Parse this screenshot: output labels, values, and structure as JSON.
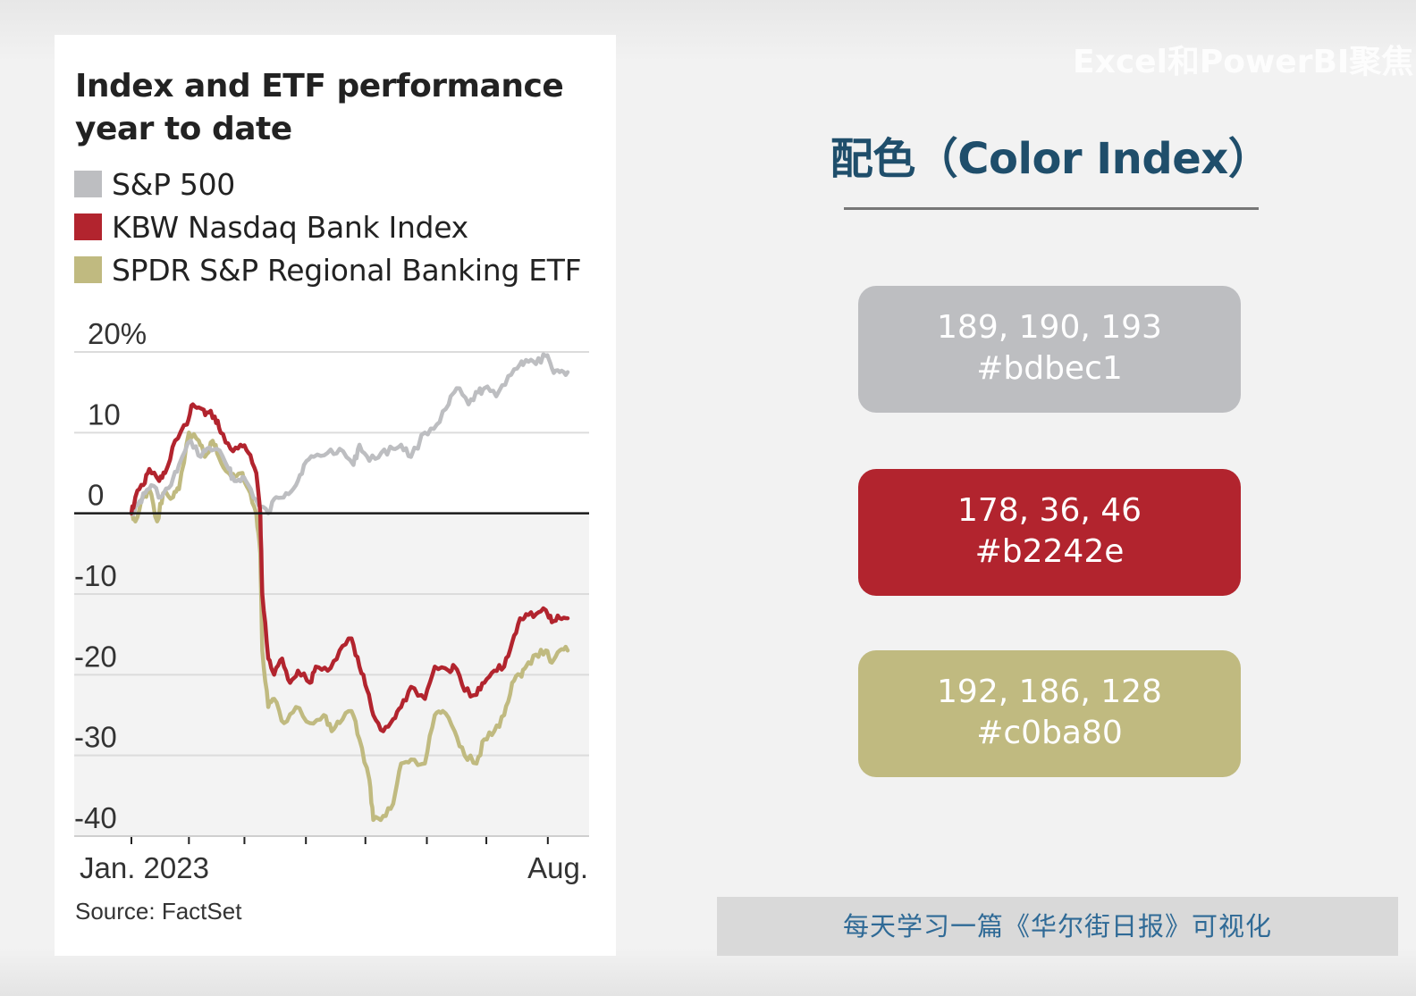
{
  "chart_data": {
    "type": "line",
    "title": "Index and ETF performance year to date",
    "source": "Source: FactSet",
    "ylim": [
      -40,
      20
    ],
    "y_ticks": [
      "20%",
      "10",
      "0",
      "-10",
      "-20",
      "-30",
      "-40"
    ],
    "x_tick_labels": {
      "start": "Jan. 2023",
      "end": "Aug."
    },
    "x_ticks": [
      "2023-01-03",
      "2023-02-01",
      "2023-03-01",
      "2023-04-01",
      "2023-05-01",
      "2023-06-01",
      "2023-07-01",
      "2023-08-01"
    ],
    "xlim": [
      "2023-01-03",
      "2023-08-11"
    ],
    "grid": true,
    "legend_position": "top-left",
    "series": [
      {
        "name": "S&P 500",
        "color": "#bdbec1",
        "points": [
          [
            "2023-01-03",
            0
          ],
          [
            "2023-01-06",
            1
          ],
          [
            "2023-01-10",
            2.5
          ],
          [
            "2023-01-13",
            3.5
          ],
          [
            "2023-01-18",
            2
          ],
          [
            "2023-01-23",
            3.5
          ],
          [
            "2023-01-27",
            6
          ],
          [
            "2023-02-02",
            9
          ],
          [
            "2023-02-07",
            7
          ],
          [
            "2023-02-10",
            8
          ],
          [
            "2023-02-15",
            8
          ],
          [
            "2023-02-21",
            5.5
          ],
          [
            "2023-02-24",
            4
          ],
          [
            "2023-02-28",
            4.5
          ],
          [
            "2023-03-03",
            3.5
          ],
          [
            "2023-03-08",
            1
          ],
          [
            "2023-03-13",
            0
          ],
          [
            "2023-03-17",
            2
          ],
          [
            "2023-03-22",
            2.5
          ],
          [
            "2023-03-27",
            3.5
          ],
          [
            "2023-03-31",
            6
          ],
          [
            "2023-04-05",
            7
          ],
          [
            "2023-04-12",
            7.5
          ],
          [
            "2023-04-18",
            8
          ],
          [
            "2023-04-25",
            6
          ],
          [
            "2023-04-28",
            8.5
          ],
          [
            "2023-05-03",
            6.5
          ],
          [
            "2023-05-09",
            7.5
          ],
          [
            "2023-05-15",
            8
          ],
          [
            "2023-05-19",
            8.5
          ],
          [
            "2023-05-24",
            7
          ],
          [
            "2023-05-31",
            10
          ],
          [
            "2023-06-06",
            11
          ],
          [
            "2023-06-12",
            13.5
          ],
          [
            "2023-06-16",
            15.5
          ],
          [
            "2023-06-22",
            13.5
          ],
          [
            "2023-06-27",
            15
          ],
          [
            "2023-06-30",
            15.5
          ],
          [
            "2023-07-06",
            14.5
          ],
          [
            "2023-07-12",
            17
          ],
          [
            "2023-07-18",
            18.5
          ],
          [
            "2023-07-21",
            19
          ],
          [
            "2023-07-26",
            18.5
          ],
          [
            "2023-07-31",
            19.5
          ],
          [
            "2023-08-03",
            18
          ],
          [
            "2023-08-07",
            17.5
          ],
          [
            "2023-08-11",
            17.5
          ]
        ]
      },
      {
        "name": "KBW Nasdaq Bank Index",
        "color": "#b2242e",
        "points": [
          [
            "2023-01-03",
            0
          ],
          [
            "2023-01-05",
            2
          ],
          [
            "2023-01-09",
            3.5
          ],
          [
            "2023-01-12",
            5.5
          ],
          [
            "2023-01-17",
            4
          ],
          [
            "2023-01-20",
            5
          ],
          [
            "2023-01-25",
            9
          ],
          [
            "2023-01-31",
            11
          ],
          [
            "2023-02-03",
            13.5
          ],
          [
            "2023-02-07",
            13
          ],
          [
            "2023-02-10",
            12.5
          ],
          [
            "2023-02-14",
            12
          ],
          [
            "2023-02-17",
            10
          ],
          [
            "2023-02-22",
            8
          ],
          [
            "2023-02-27",
            8.5
          ],
          [
            "2023-03-03",
            7.5
          ],
          [
            "2023-03-07",
            5
          ],
          [
            "2023-03-09",
            0
          ],
          [
            "2023-03-10",
            -10
          ],
          [
            "2023-03-13",
            -18
          ],
          [
            "2023-03-16",
            -20
          ],
          [
            "2023-03-20",
            -18
          ],
          [
            "2023-03-24",
            -21
          ],
          [
            "2023-03-28",
            -19.5
          ],
          [
            "2023-04-03",
            -21
          ],
          [
            "2023-04-06",
            -19
          ],
          [
            "2023-04-12",
            -19.5
          ],
          [
            "2023-04-18",
            -17
          ],
          [
            "2023-04-24",
            -15.5
          ],
          [
            "2023-04-28",
            -19
          ],
          [
            "2023-05-02",
            -22
          ],
          [
            "2023-05-05",
            -25
          ],
          [
            "2023-05-10",
            -27
          ],
          [
            "2023-05-15",
            -25.5
          ],
          [
            "2023-05-19",
            -24
          ],
          [
            "2023-05-24",
            -21.5
          ],
          [
            "2023-05-31",
            -23
          ],
          [
            "2023-06-05",
            -19
          ],
          [
            "2023-06-12",
            -19.5
          ],
          [
            "2023-06-15",
            -19
          ],
          [
            "2023-06-20",
            -22
          ],
          [
            "2023-06-26",
            -22.5
          ],
          [
            "2023-06-30",
            -21
          ],
          [
            "2023-07-05",
            -19.5
          ],
          [
            "2023-07-10",
            -19
          ],
          [
            "2023-07-14",
            -16
          ],
          [
            "2023-07-18",
            -13
          ],
          [
            "2023-07-21",
            -12.5
          ],
          [
            "2023-07-26",
            -12.5
          ],
          [
            "2023-07-31",
            -12
          ],
          [
            "2023-08-03",
            -13.5
          ],
          [
            "2023-08-07",
            -13
          ],
          [
            "2023-08-11",
            -13
          ]
        ]
      },
      {
        "name": "SPDR S&P Regional Banking ETF",
        "color": "#c0ba80",
        "points": [
          [
            "2023-01-03",
            0
          ],
          [
            "2023-01-05",
            -1
          ],
          [
            "2023-01-09",
            2
          ],
          [
            "2023-01-12",
            3
          ],
          [
            "2023-01-16",
            -1
          ],
          [
            "2023-01-19",
            2.5
          ],
          [
            "2023-01-24",
            2
          ],
          [
            "2023-01-27",
            3
          ],
          [
            "2023-02-01",
            10
          ],
          [
            "2023-02-06",
            9
          ],
          [
            "2023-02-09",
            7
          ],
          [
            "2023-02-13",
            9
          ],
          [
            "2023-02-16",
            7
          ],
          [
            "2023-02-21",
            5
          ],
          [
            "2023-02-24",
            4.5
          ],
          [
            "2023-02-28",
            5
          ],
          [
            "2023-03-03",
            3
          ],
          [
            "2023-03-07",
            0
          ],
          [
            "2023-03-09",
            -5
          ],
          [
            "2023-03-10",
            -17
          ],
          [
            "2023-03-13",
            -24
          ],
          [
            "2023-03-16",
            -23
          ],
          [
            "2023-03-21",
            -26
          ],
          [
            "2023-03-27",
            -24
          ],
          [
            "2023-04-03",
            -26
          ],
          [
            "2023-04-10",
            -25
          ],
          [
            "2023-04-14",
            -27
          ],
          [
            "2023-04-18",
            -26
          ],
          [
            "2023-04-24",
            -24.5
          ],
          [
            "2023-04-28",
            -28
          ],
          [
            "2023-05-03",
            -33
          ],
          [
            "2023-05-05",
            -38
          ],
          [
            "2023-05-10",
            -37.5
          ],
          [
            "2023-05-15",
            -36
          ],
          [
            "2023-05-19",
            -31
          ],
          [
            "2023-05-24",
            -30.5
          ],
          [
            "2023-05-31",
            -31
          ],
          [
            "2023-06-05",
            -25
          ],
          [
            "2023-06-09",
            -24.5
          ],
          [
            "2023-06-15",
            -27
          ],
          [
            "2023-06-20",
            -30
          ],
          [
            "2023-06-26",
            -31
          ],
          [
            "2023-06-30",
            -28
          ],
          [
            "2023-07-05",
            -27
          ],
          [
            "2023-07-10",
            -25
          ],
          [
            "2023-07-14",
            -21
          ],
          [
            "2023-07-18",
            -20
          ],
          [
            "2023-07-21",
            -19
          ],
          [
            "2023-07-26",
            -17.5
          ],
          [
            "2023-07-31",
            -17
          ],
          [
            "2023-08-03",
            -18.5
          ],
          [
            "2023-08-07",
            -17
          ],
          [
            "2023-08-11",
            -17
          ]
        ]
      }
    ]
  },
  "palette": {
    "title": "配色（Color Index）",
    "swatches": [
      {
        "rgb": "189, 190, 193",
        "hex": "#bdbec1",
        "color": "#bdbec1"
      },
      {
        "rgb": "178, 36, 46",
        "hex": "#b2242e",
        "color": "#b2242e"
      },
      {
        "rgb": "192, 186, 128",
        "hex": "#c0ba80",
        "color": "#c0ba80"
      }
    ]
  },
  "watermark": "Excel和PowerBI聚焦",
  "caption": "每天学习一篇《华尔街日报》可视化"
}
